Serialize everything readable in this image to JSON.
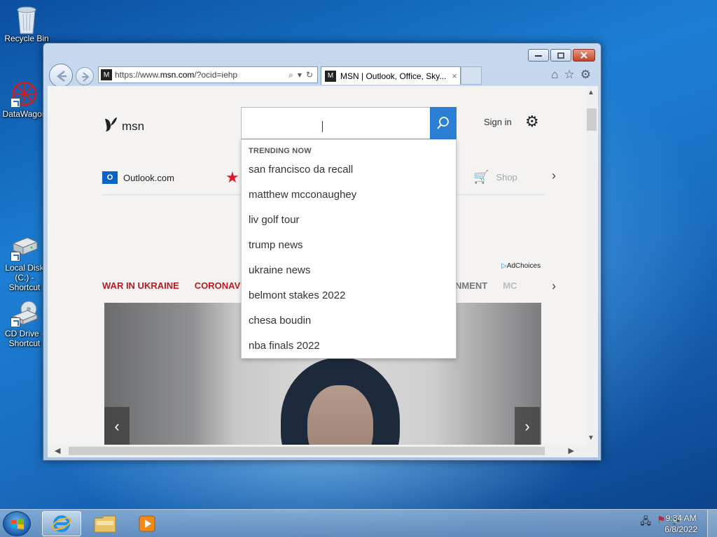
{
  "desktop": {
    "icons": [
      {
        "label": "Recycle Bin"
      },
      {
        "label": "DataWagon"
      },
      {
        "label": "Local Disk (C:) - Shortcut"
      },
      {
        "label": "CD Drive - Shortcut"
      }
    ]
  },
  "browser": {
    "address_url_prefix": "https://www.",
    "address_url_domain": "msn.com",
    "address_url_suffix": "/?ocid=iehp",
    "tab_title": "MSN | Outlook, Office, Sky...",
    "tab_close": "×",
    "favicon": "M"
  },
  "msn": {
    "logo_text": "msn",
    "sign_in": "Sign in",
    "search_placeholder": "",
    "outlook_label": "Outlook.com",
    "shop_label": "Shop",
    "adchoices_label": "AdChoices",
    "categories_left": [
      "WAR IN UKRAINE",
      "CORONAVI"
    ],
    "categories_right": [
      "NMENT",
      "MC"
    ],
    "suggestions": {
      "header": "TRENDING NOW",
      "items": [
        "san francisco da recall",
        "matthew mcconaughey",
        "liv golf tour",
        "trump news",
        "ukraine news",
        "belmont stakes 2022",
        "chesa boudin",
        "nba finals 2022"
      ]
    }
  },
  "taskbar": {
    "time": "9:34 AM",
    "date": "6/8/2022"
  },
  "colors": {
    "accent": "#2a7fd4",
    "category_red": "#b21d24"
  }
}
